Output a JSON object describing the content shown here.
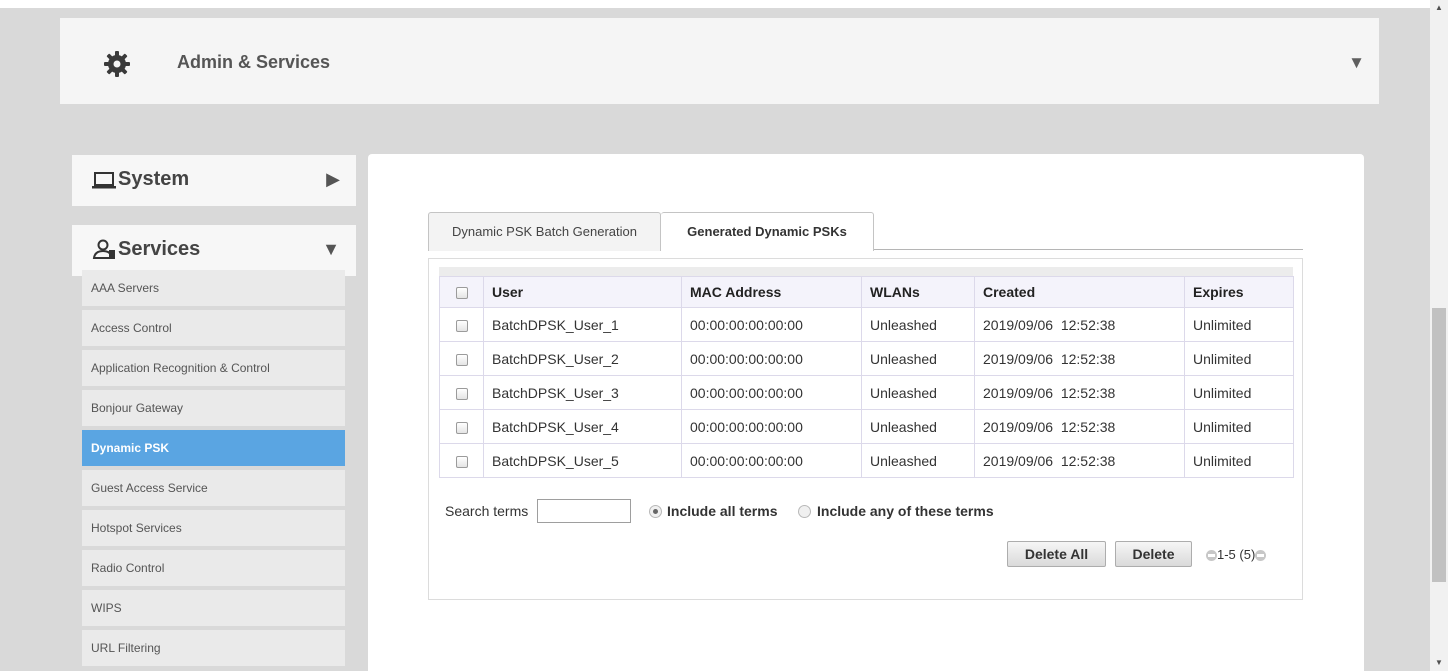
{
  "header": {
    "title": "Admin & Services",
    "icon": "gear-icon",
    "toggle": "▼"
  },
  "sidebar": {
    "system": {
      "label": "System",
      "icon": "laptop-icon",
      "arrow": "▶"
    },
    "services": {
      "label": "Services",
      "icon": "services-icon",
      "arrow": "▼"
    },
    "items": [
      {
        "label": "AAA Servers"
      },
      {
        "label": "Access Control"
      },
      {
        "label": "Application Recognition & Control"
      },
      {
        "label": "Bonjour Gateway"
      },
      {
        "label": "Dynamic PSK",
        "active": true
      },
      {
        "label": "Guest Access Service"
      },
      {
        "label": "Hotspot Services"
      },
      {
        "label": "Radio Control"
      },
      {
        "label": "WIPS"
      },
      {
        "label": "URL Filtering"
      }
    ]
  },
  "tabs": [
    {
      "label": "Dynamic PSK Batch Generation"
    },
    {
      "label": "Generated Dynamic PSKs",
      "active": true
    }
  ],
  "table": {
    "columns": [
      "User",
      "MAC Address",
      "WLANs",
      "Created",
      "Expires"
    ],
    "rows": [
      [
        "BatchDPSK_User_1",
        "00:00:00:00:00:00",
        "Unleashed",
        "2019/09/06  12:52:38",
        "Unlimited"
      ],
      [
        "BatchDPSK_User_2",
        "00:00:00:00:00:00",
        "Unleashed",
        "2019/09/06  12:52:38",
        "Unlimited"
      ],
      [
        "BatchDPSK_User_3",
        "00:00:00:00:00:00",
        "Unleashed",
        "2019/09/06  12:52:38",
        "Unlimited"
      ],
      [
        "BatchDPSK_User_4",
        "00:00:00:00:00:00",
        "Unleashed",
        "2019/09/06  12:52:38",
        "Unlimited"
      ],
      [
        "BatchDPSK_User_5",
        "00:00:00:00:00:00",
        "Unleashed",
        "2019/09/06  12:52:38",
        "Unlimited"
      ]
    ]
  },
  "search": {
    "label": "Search terms",
    "value": "",
    "option_all": "Include all terms",
    "option_any": "Include any of these terms",
    "selected": "all"
  },
  "buttons": {
    "delete_all": "Delete All",
    "delete": "Delete"
  },
  "pager": {
    "text": "1-5 (5)"
  },
  "colors": {
    "accent": "#5aa5e2",
    "background": "#d9d9d9"
  }
}
